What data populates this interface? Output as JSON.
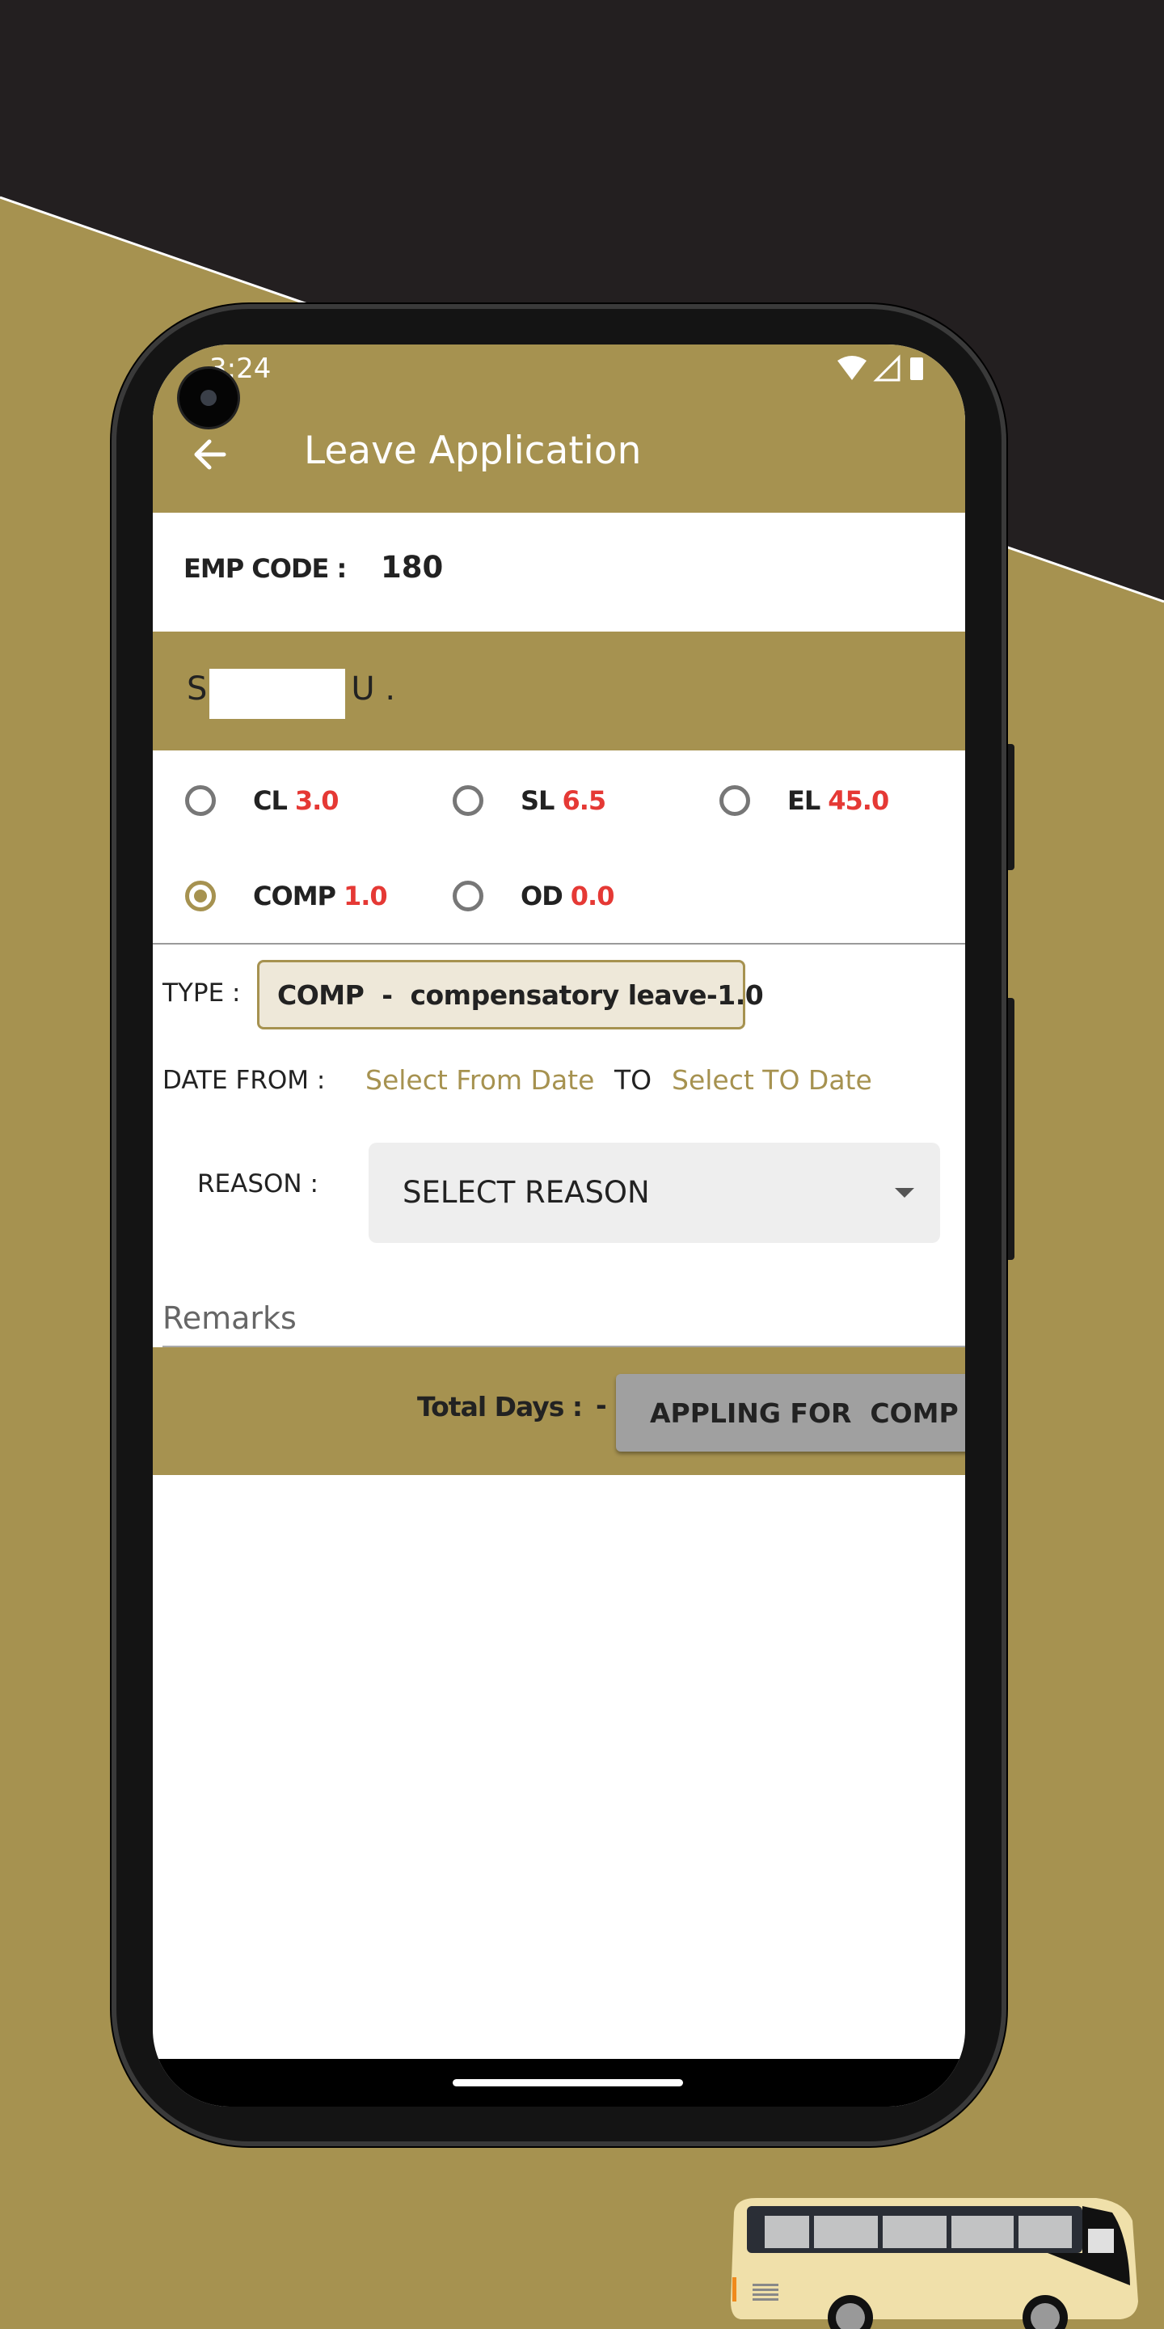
{
  "colors": {
    "brand": "#A69250",
    "dark_bg": "#231F20",
    "balance_red": "#E53935",
    "chip_bg": "#EEE8D9"
  },
  "status_bar": {
    "time": "3:24",
    "icons": [
      "wifi-icon",
      "signal-icon",
      "battery-icon"
    ]
  },
  "app_bar": {
    "title": "Leave Application",
    "back_icon": "arrow-left-icon"
  },
  "employee": {
    "code_label": "EMP CODE :",
    "code_value": "180",
    "name_visible": "S              U ."
  },
  "leave_types": [
    {
      "code": "CL",
      "balance": "3.0",
      "selected": false
    },
    {
      "code": "SL",
      "balance": "6.5",
      "selected": false
    },
    {
      "code": "EL",
      "balance": "45.0",
      "selected": false
    },
    {
      "code": "COMP",
      "balance": "1.0",
      "selected": true
    },
    {
      "code": "OD",
      "balance": "0.0",
      "selected": false
    }
  ],
  "form": {
    "type_label": "TYPE :",
    "type_value": "COMP  -  compensatory leave-1.0",
    "date_from_label": "DATE FROM :",
    "date_from_value": "Select From Date",
    "to_label": "TO",
    "date_to_value": "Select TO Date",
    "reason_label": "REASON :",
    "reason_value": "SELECT REASON",
    "remarks_placeholder": "Remarks"
  },
  "footer": {
    "total_days_label": "Total Days :",
    "total_days_value": "-",
    "apply_button": "APPLING FOR  COMP"
  }
}
